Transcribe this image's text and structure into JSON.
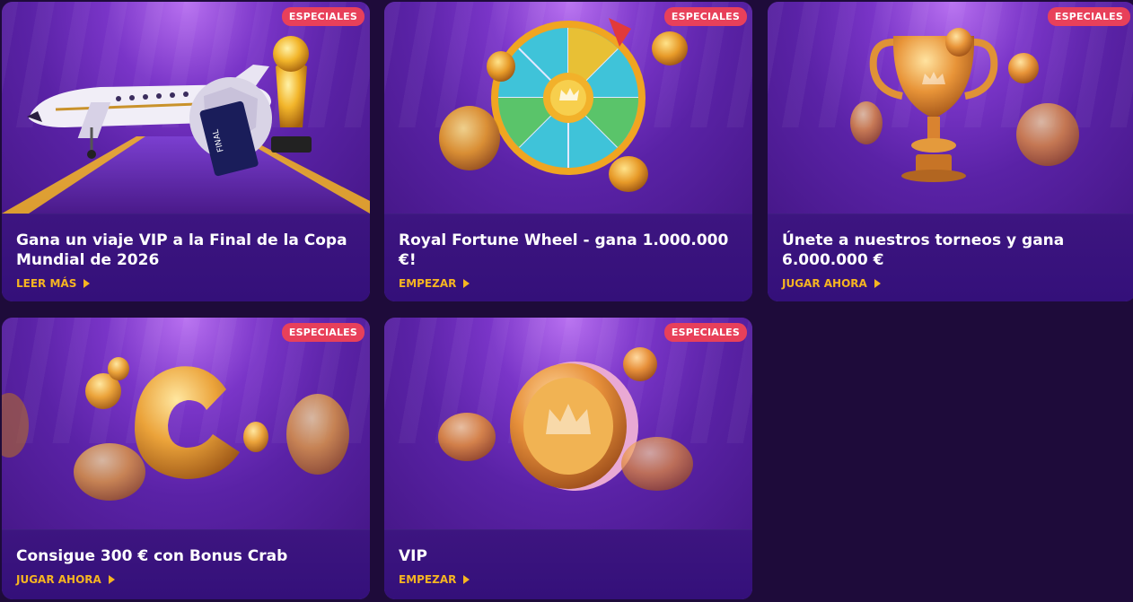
{
  "cards": [
    {
      "badge": "ESPECIALES",
      "title": "Gana un viaje VIP a la Final de la Copa Mundial de 2026",
      "cta": "LEER MÁS",
      "image": "plane-trophy-football-ticket"
    },
    {
      "badge": "ESPECIALES",
      "title": "Royal Fortune Wheel - gana 1.000.000 €!",
      "cta": "EMPEZAR",
      "image": "fortune-wheel-coins"
    },
    {
      "badge": "ESPECIALES",
      "title": "Únete a nuestros torneos y gana 6.000.000 €",
      "cta": "JUGAR AHORA",
      "image": "gold-trophy-coins"
    },
    {
      "badge": "ESPECIALES",
      "title": "Consigue 300 € con Bonus Crab",
      "cta": "JUGAR AHORA",
      "image": "gold-c-crab-coins"
    },
    {
      "badge": "ESPECIALES",
      "title": "VIP",
      "cta": "EMPEZAR",
      "image": "vip-coin"
    }
  ],
  "colors": {
    "background": "#1e0b3a",
    "badge": "#e8405a",
    "cta": "#f6b521",
    "title": "#ffffff"
  }
}
